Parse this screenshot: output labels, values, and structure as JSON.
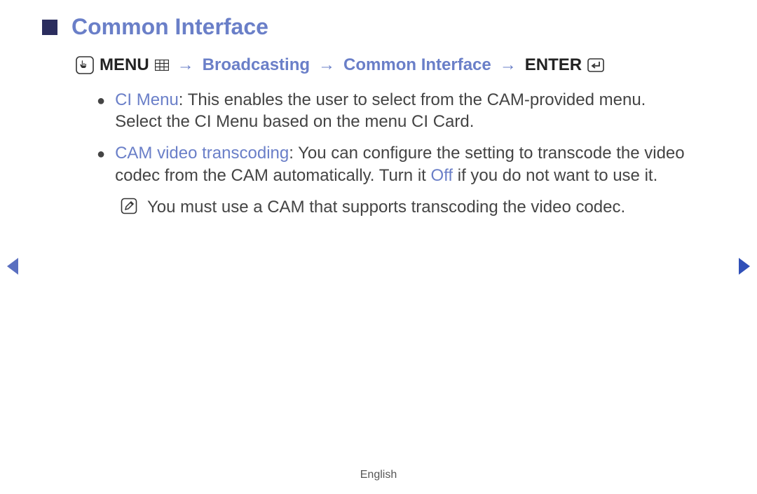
{
  "title": "Common Interface",
  "breadcrumb": {
    "menu_label": "MENU",
    "arrow": "→",
    "path1": "Broadcasting",
    "path2": "Common Interface",
    "enter_label": "ENTER"
  },
  "items": [
    {
      "term": "CI Menu",
      "text": ": This enables the user to select from the CAM-provided menu. Select the CI Menu based on the menu CI Card."
    },
    {
      "term": "CAM video transcoding",
      "text_before": ": You can configure the setting to transcode the video codec from the CAM automatically. Turn it ",
      "off_word": "Off",
      "text_after": " if you do not want to use it."
    }
  ],
  "note": "You must use a CAM that supports transcoding the video codec.",
  "footer": "English"
}
